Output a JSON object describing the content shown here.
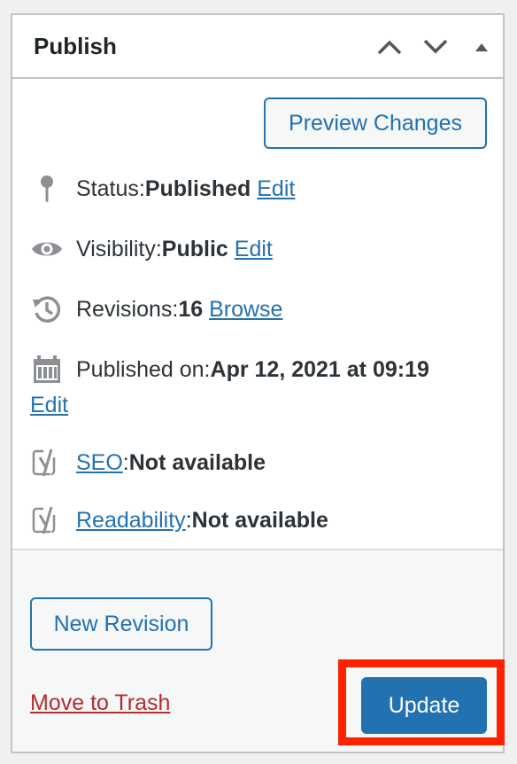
{
  "panel": {
    "title": "Publish",
    "controls": {
      "move_up_icon": "chevron-up-icon",
      "move_down_icon": "chevron-down-icon",
      "toggle_icon": "triangle-up-icon"
    }
  },
  "preview": {
    "label": "Preview Changes"
  },
  "status": {
    "label": "Status: ",
    "value": "Published",
    "action": "Edit",
    "icon": "pin-icon"
  },
  "visibility": {
    "label": "Visibility: ",
    "value": "Public",
    "action": "Edit",
    "icon": "eye-icon"
  },
  "revisions": {
    "label": "Revisions: ",
    "value": "16",
    "action": "Browse",
    "icon": "history-icon"
  },
  "published_on": {
    "label": "Published on: ",
    "value": "Apr 12, 2021 at 09:19",
    "action": "Edit",
    "icon": "calendar-icon"
  },
  "seo": {
    "link": "SEO",
    "sep": ": ",
    "value": "Not available",
    "icon": "yoast-icon"
  },
  "readability": {
    "link": "Readability",
    "sep": ": ",
    "value": "Not available",
    "icon": "yoast-icon"
  },
  "footer": {
    "new_revision": "New Revision",
    "trash": "Move to Trash",
    "update": "Update"
  },
  "colors": {
    "accent": "#2271b1",
    "danger": "#b32d2e",
    "highlight": "#ff2200"
  }
}
